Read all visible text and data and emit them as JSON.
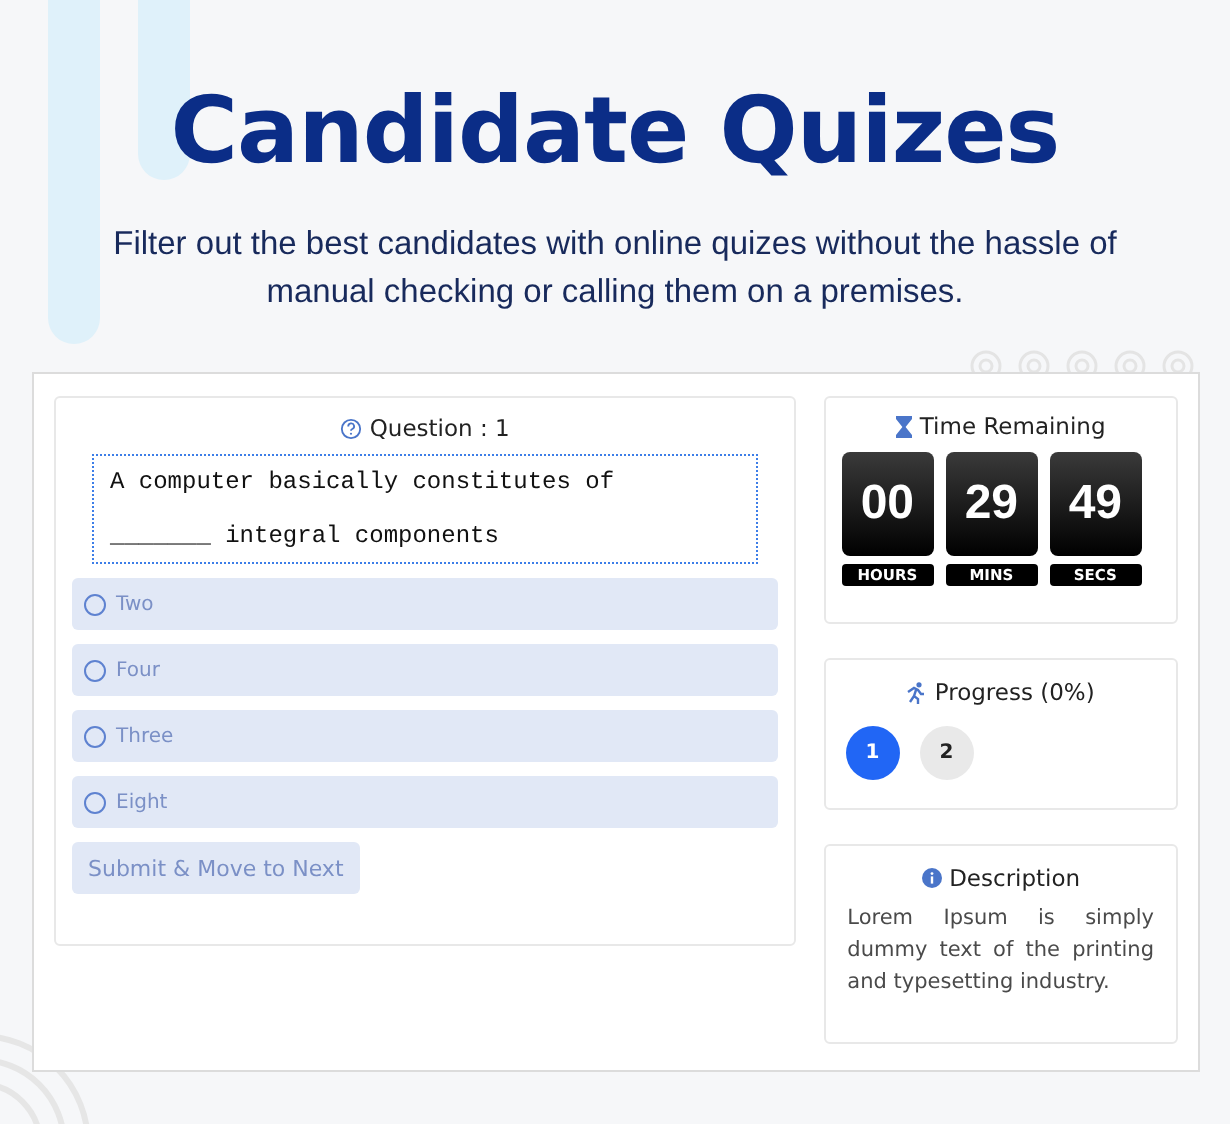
{
  "header": {
    "title": "Candidate Quizes",
    "subtitle": "Filter out the best candidates with online quizes without the hassle of manual checking or calling them on a premises."
  },
  "quiz": {
    "question_label": "Question : 1",
    "question_lines": [
      "A computer basically constitutes of",
      "_______ integral components"
    ],
    "options": [
      {
        "label": "Two",
        "selected": false
      },
      {
        "label": "Four",
        "selected": false
      },
      {
        "label": "Three",
        "selected": false
      },
      {
        "label": "Eight",
        "selected": false
      }
    ],
    "submit": "Submit & Move to Next"
  },
  "timer": {
    "title": "Time Remaining",
    "units": [
      {
        "value": "00",
        "label": "HOURS"
      },
      {
        "value": "29",
        "label": "MINS"
      },
      {
        "value": "49",
        "label": "SECS"
      }
    ]
  },
  "progress": {
    "title": "Progress (0%)",
    "steps": [
      {
        "label": "1",
        "selected": true
      },
      {
        "label": "2",
        "selected": false
      }
    ]
  },
  "description": {
    "title": "Description",
    "text": "Lorem Ipsum is simply dummy text of the printing and typesetting industry."
  }
}
